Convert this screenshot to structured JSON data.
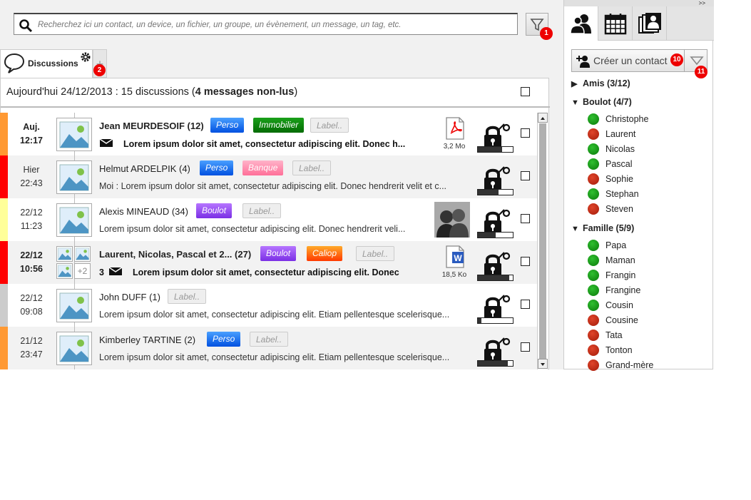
{
  "search": {
    "placeholder": "Recherchez ici un contact, un device, un fichier, un groupe, un évènement, un message, un tag, etc.",
    "filter_badge": "1"
  },
  "tabs": {
    "discussions_label": "Discussions",
    "plus_badge": "2"
  },
  "summary": {
    "prefix": "Aujourd'hui 24/12/2013 : 15 discussions (",
    "unread": "4 messages non-lus",
    "suffix": ")"
  },
  "rows": [
    {
      "day": "Auj.",
      "time": "12:17",
      "name": "Jean MEURDESOIF (12)",
      "bold": true,
      "tags": [
        {
          "label": "Perso",
          "type": "perso"
        },
        {
          "label": "Immobilier",
          "type": "immo"
        },
        {
          "label": "Label..",
          "type": "empty"
        }
      ],
      "msg_prefix": "",
      "message": "Lorem ipsum dolor sit amet, consectetur adipiscing elit. Donec h...",
      "attachment": "pdf",
      "attachment_size": "3,2 Mo",
      "progress": 0.7,
      "color": "#ff9933"
    },
    {
      "day": "Hier",
      "time": "22:43",
      "name": "Helmut ARDELPIK (4)",
      "bold": false,
      "tags": [
        {
          "label": "Perso",
          "type": "perso"
        },
        {
          "label": "Banque",
          "type": "banque"
        },
        {
          "label": "Label..",
          "type": "empty"
        }
      ],
      "msg_prefix": "Moi : ",
      "message": "Lorem ipsum dolor sit amet, consectetur adipiscing elit. Donec hendrerit velit et c...",
      "progress": 0.6,
      "color": "#ff0000"
    },
    {
      "day": "22/12",
      "time": "11:23",
      "name": "Alexis MINEAUD (34)",
      "bold": false,
      "tags": [
        {
          "label": "Boulot",
          "type": "boulot"
        },
        {
          "label": "Label..",
          "type": "empty"
        }
      ],
      "msg_prefix": "",
      "message": "Lorem ipsum dolor sit amet, consectetur adipiscing elit. Donec hendrerit veli...",
      "attachment": "photo",
      "progress": 0.5,
      "color": "#ffff99"
    },
    {
      "day": "22/12",
      "time": "10:56",
      "name": "Laurent, Nicolas, Pascal et 2... (27)",
      "bold": true,
      "tags": [
        {
          "label": "Boulot",
          "type": "boulot"
        },
        {
          "label": "Caliop",
          "type": "caliop"
        },
        {
          "label": "Label..",
          "type": "empty"
        }
      ],
      "msg_prefix": "3",
      "message": "Lorem ipsum dolor sit amet, consectetur adipiscing elit. Donec",
      "attachment": "word",
      "attachment_size": "18,5 Ko",
      "progress": 0.9,
      "color": "#ff0000",
      "group_more": "+2"
    },
    {
      "day": "22/12",
      "time": "09:08",
      "name": "John DUFF (1)",
      "bold": false,
      "tags": [
        {
          "label": "Label..",
          "type": "empty"
        }
      ],
      "msg_prefix": "",
      "message": "Lorem ipsum dolor sit amet, consectetur adipiscing elit. Etiam pellentesque scelerisque...",
      "progress": 0.1,
      "color": "#cccccc"
    },
    {
      "day": "21/12",
      "time": "23:47",
      "name": "Kimberley TARTINE (2)",
      "bold": false,
      "tags": [
        {
          "label": "Perso",
          "type": "perso"
        },
        {
          "label": "Label..",
          "type": "empty"
        }
      ],
      "msg_prefix": "",
      "message": "Lorem ipsum dolor sit amet, consectetur adipiscing elit. Etiam pellentesque scelerisque...",
      "progress": 0.85,
      "color": "#ff9933"
    }
  ],
  "sidebar": {
    "collapse": ">>",
    "create_label": "Créer un contact",
    "create_badge": "10",
    "filter_badge": "11",
    "groups": [
      {
        "label": "Amis (3/12)",
        "open": false,
        "contacts": []
      },
      {
        "label": "Boulot (4/7)",
        "open": true,
        "contacts": [
          {
            "name": "Christophe",
            "online": true
          },
          {
            "name": "Laurent",
            "online": false
          },
          {
            "name": "Nicolas",
            "online": true
          },
          {
            "name": "Pascal",
            "online": true
          },
          {
            "name": "Sophie",
            "online": false
          },
          {
            "name": "Stephan",
            "online": true
          },
          {
            "name": "Steven",
            "online": false
          }
        ]
      },
      {
        "label": "Famille (5/9)",
        "open": true,
        "contacts": [
          {
            "name": "Papa",
            "online": true
          },
          {
            "name": "Maman",
            "online": true
          },
          {
            "name": "Frangin",
            "online": true
          },
          {
            "name": "Frangine",
            "online": true
          },
          {
            "name": "Cousin",
            "online": true
          },
          {
            "name": "Cousine",
            "online": false
          },
          {
            "name": "Tata",
            "online": false
          },
          {
            "name": "Tonton",
            "online": false
          },
          {
            "name": "Grand-mère",
            "online": false
          }
        ]
      }
    ]
  }
}
